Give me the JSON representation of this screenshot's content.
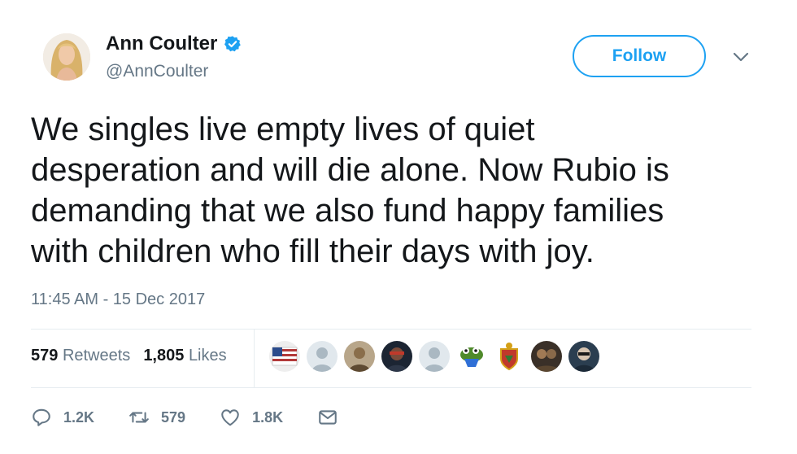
{
  "author": {
    "name": "Ann Coulter",
    "handle": "@AnnCoulter",
    "verified": true,
    "avatar_icon": "profile-photo"
  },
  "follow_label": "Follow",
  "tweet": {
    "text": "We singles live empty lives of quiet\ndesperation and will die alone. Now Rubio is\ndemanding that we also fund happy families\nwith children who fill their days with joy.",
    "timestamp": "11:45 AM - 15 Dec 2017"
  },
  "stats": {
    "retweets_count": "579",
    "retweets_label": "Retweets",
    "likes_count": "1,805",
    "likes_label": "Likes"
  },
  "liker_avatars": [
    {
      "icon": "flag-avatar",
      "color": "#b23a3a"
    },
    {
      "icon": "default-avatar",
      "color": "#aab8c2"
    },
    {
      "icon": "photo-avatar",
      "color": "#8a6e4b"
    },
    {
      "icon": "photo-avatar",
      "color": "#2d3748"
    },
    {
      "icon": "default-avatar",
      "color": "#aab8c2"
    },
    {
      "icon": "frog-avatar",
      "color": "#4f8a2b"
    },
    {
      "icon": "crest-avatar",
      "color": "#c0392b"
    },
    {
      "icon": "photo-avatar",
      "color": "#5a4630"
    },
    {
      "icon": "photo-avatar",
      "color": "#2b3e50"
    }
  ],
  "actions": {
    "replies": "1.2K",
    "retweets": "579",
    "likes": "1.8K"
  },
  "colors": {
    "accent": "#1da1f2",
    "secondary_text": "#657786",
    "primary_text": "#14171a"
  }
}
